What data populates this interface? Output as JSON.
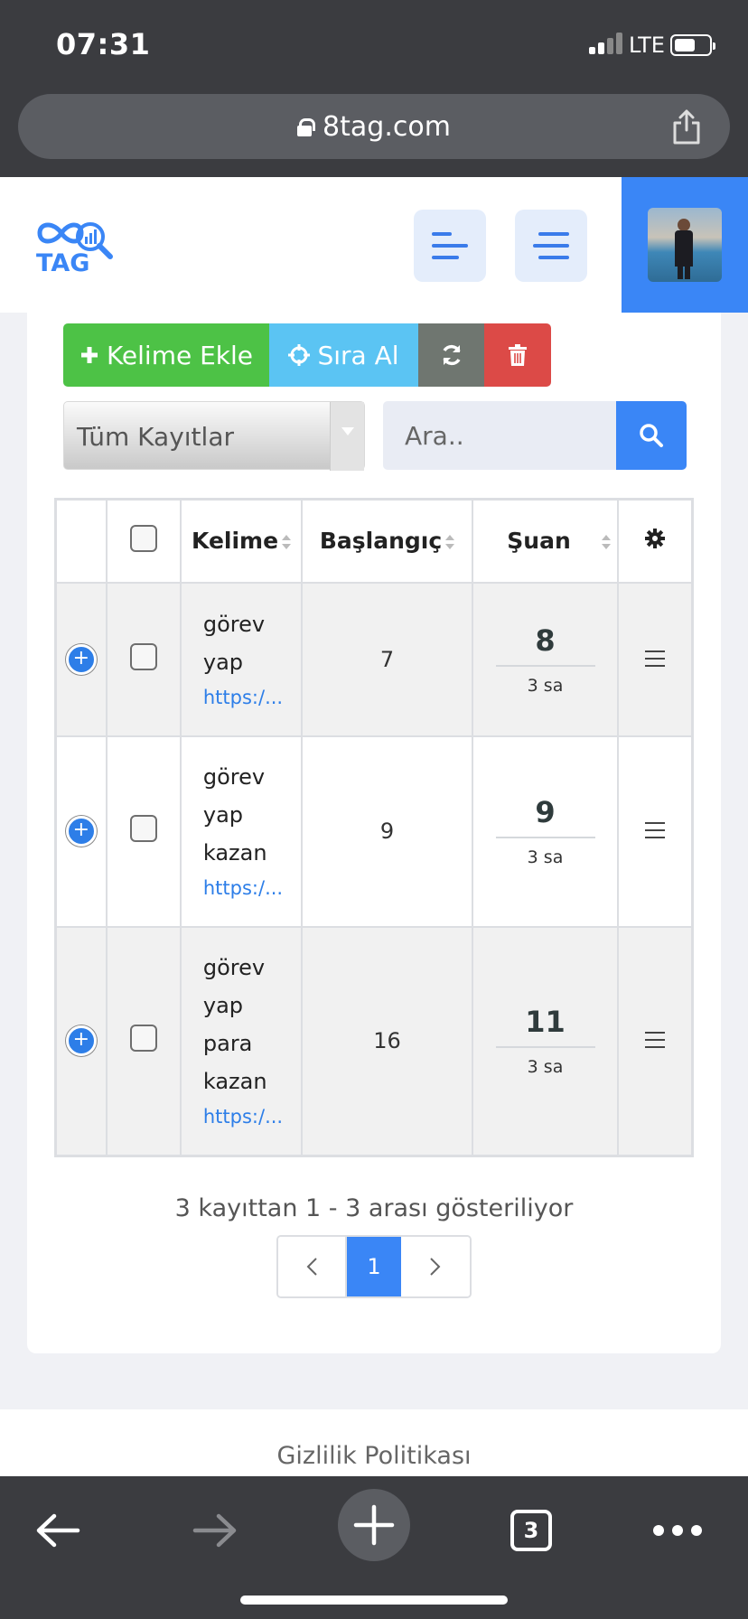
{
  "status_bar": {
    "time": "07:31",
    "network": "LTE"
  },
  "browser": {
    "url": "8tag.com",
    "tabs_count": "3"
  },
  "header": {
    "logo_text": "TAG"
  },
  "toolbar": {
    "add_keyword": "Kelime Ekle",
    "get_rank": "Sıra Al"
  },
  "filter": {
    "selected": "Tüm Kayıtlar"
  },
  "search": {
    "placeholder": "Ara.."
  },
  "table": {
    "headers": {
      "keyword": "Kelime",
      "start": "Başlangıç",
      "current": "Şuan"
    },
    "rows": [
      {
        "keyword_lines": [
          "görev",
          "yap"
        ],
        "link": "https:/...",
        "start": "7",
        "current": "8",
        "updated": "3 sa"
      },
      {
        "keyword_lines": [
          "görev",
          "yap",
          "kazan"
        ],
        "link": "https:/...",
        "start": "9",
        "current": "9",
        "updated": "3 sa"
      },
      {
        "keyword_lines": [
          "görev",
          "yap",
          "para",
          "kazan"
        ],
        "link": "https:/...",
        "start": "16",
        "current": "11",
        "updated": "3 sa"
      }
    ]
  },
  "pagination": {
    "info": "3 kayıttan 1 - 3 arası gösteriliyor",
    "current_page": "1"
  },
  "footer": {
    "privacy": "Gizlilik Politikası"
  },
  "colors": {
    "green": "#4dc246",
    "cyan": "#5bc4f3",
    "gray": "#6f7670",
    "red": "#dc4a47",
    "blue": "#3a86f6"
  }
}
